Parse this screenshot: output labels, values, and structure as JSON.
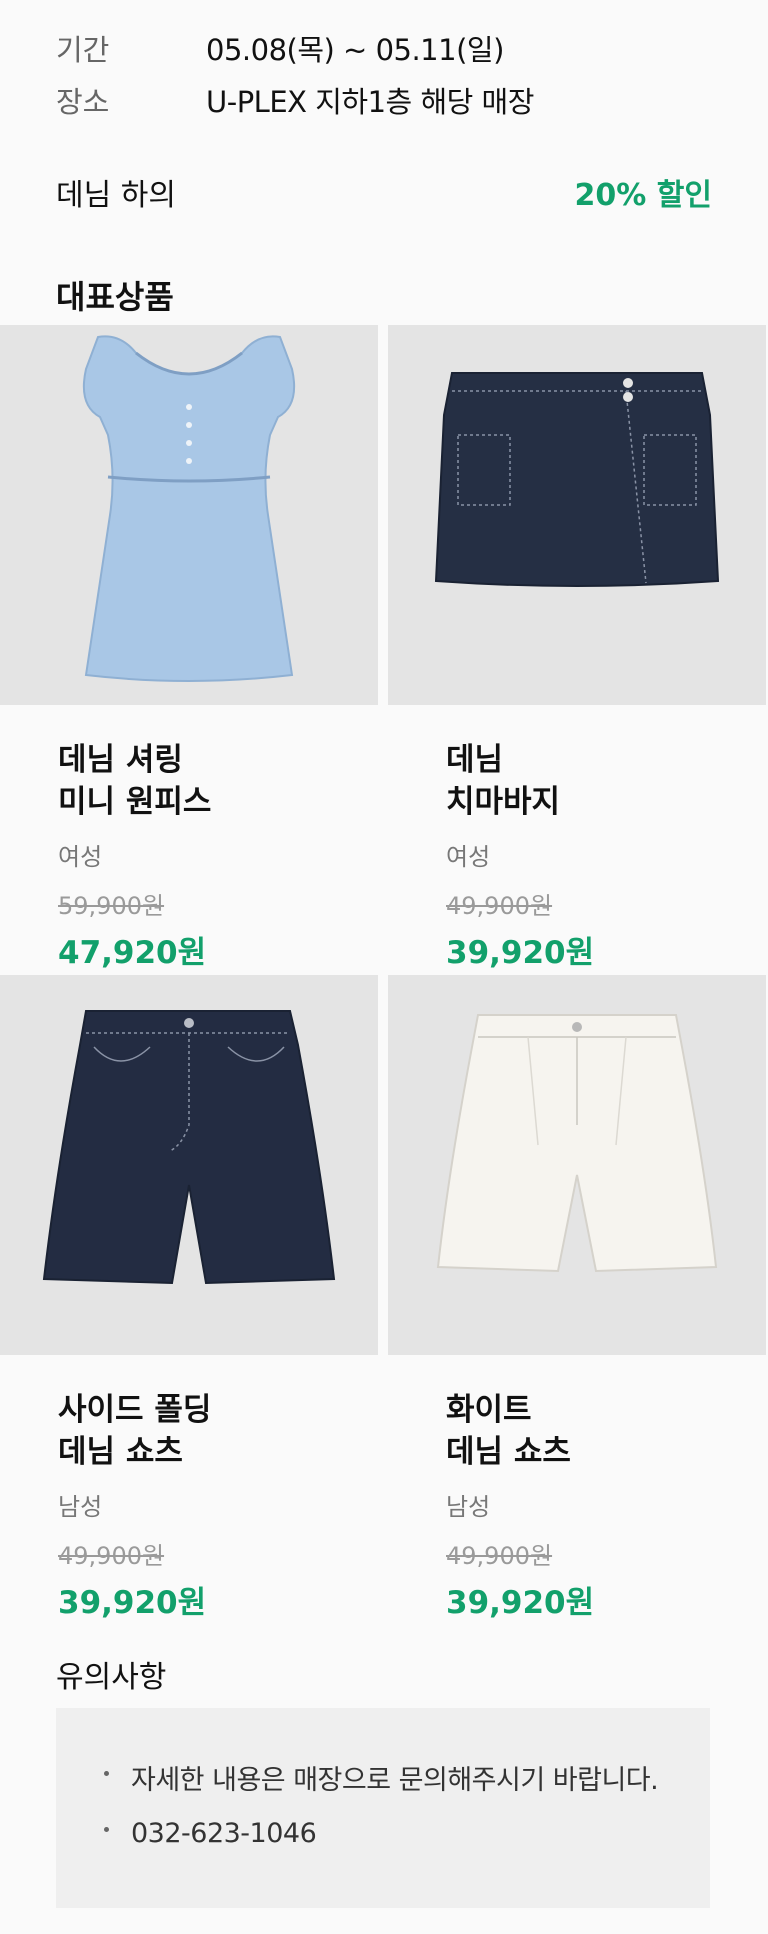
{
  "event": {
    "period_label": "기간",
    "period_value": "05.08(목) ~ 05.11(일)",
    "place_label": "장소",
    "place_value": "U-PLEX 지하1층 해당 매장"
  },
  "discount": {
    "category": "데님 하의",
    "rate": "20% 할인",
    "accent_color": "#12a06b"
  },
  "section_title": "대표상품",
  "products": [
    {
      "name": "데님 셔링\n미니 원피스",
      "gender": "여성",
      "original_price": "59,900원",
      "sale_price": "47,920원",
      "image": "denim-dress-image"
    },
    {
      "name": "데님\n치마바지",
      "gender": "여성",
      "original_price": "49,900원",
      "sale_price": "39,920원",
      "image": "denim-skirt-image"
    },
    {
      "name": "사이드 폴딩\n데님 쇼츠",
      "gender": "남성",
      "original_price": "49,900원",
      "sale_price": "39,920원",
      "image": "denim-shorts-image"
    },
    {
      "name": "화이트\n데님 쇼츠",
      "gender": "남성",
      "original_price": "49,900원",
      "sale_price": "39,920원",
      "image": "white-shorts-image"
    }
  ],
  "notice": {
    "title": "유의사항",
    "items": [
      "자세한 내용은 매장으로 문의해주시기 바랍니다.",
      "032-623-1046"
    ]
  }
}
